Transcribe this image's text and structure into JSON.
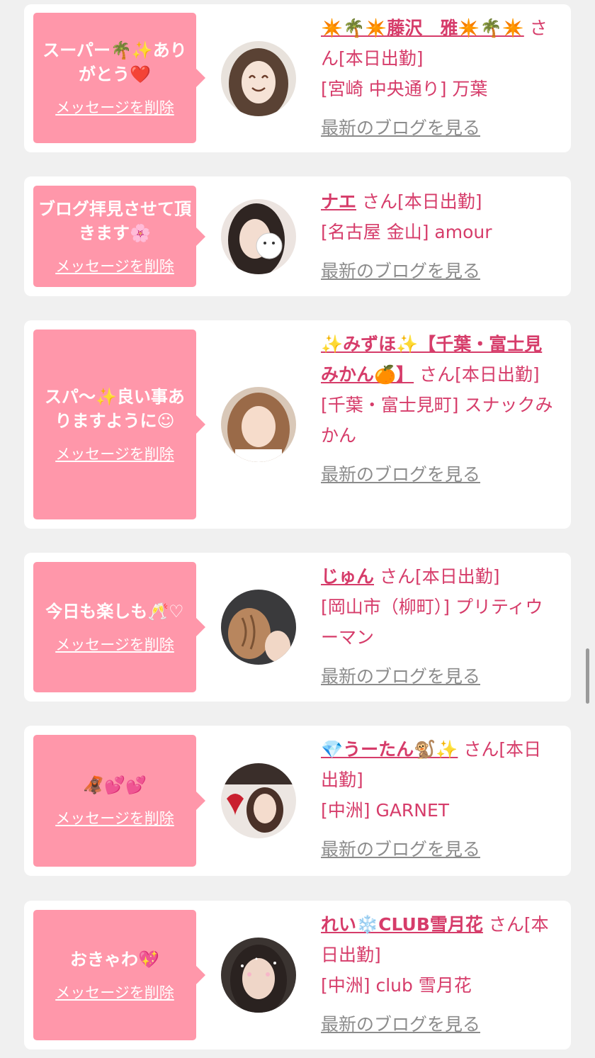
{
  "colors": {
    "bubble": "#ff97aa",
    "text_pink": "#d63c6a",
    "link_gray": "#8c8c8c",
    "page_bg": "#f0f0f0"
  },
  "entries": [
    {
      "message": "スーパー🌴✨ありがとう❤️",
      "delete_label": "メッセージを削除",
      "name": "✴️🌴✴️藤沢　雅✴️🌴✴️",
      "suffix": "さん[本日出勤]",
      "shop": "[宮崎 中央通り] 万葉",
      "blog_label": "最新のブログを見る"
    },
    {
      "message": "ブログ拝見させて頂きます🌸",
      "delete_label": "メッセージを削除",
      "name": "ナエ",
      "suffix": "さん[本日出勤]",
      "shop": "[名古屋 金山] amour",
      "blog_label": "最新のブログを見る"
    },
    {
      "message": "スパ〜✨良い事ありますように☺",
      "delete_label": "メッセージを削除",
      "name": "✨みずほ✨【千葉・富士見みかん🍊】",
      "suffix": "さん[本日出勤]",
      "shop": "[千葉・富士見町] スナックみかん",
      "blog_label": "最新のブログを見る"
    },
    {
      "message": "今日も楽しも🥂♡",
      "delete_label": "メッセージを削除",
      "name": "じゅん",
      "suffix": "さん[本日出勤]",
      "shop": "[岡山市（柳町）] プリティウーマン",
      "blog_label": "最新のブログを見る"
    },
    {
      "message": "🦧💕💕",
      "delete_label": "メッセージを削除",
      "name": "💎うーたん🐒✨",
      "suffix": "さん[本日出勤]",
      "shop": "[中洲] GARNET",
      "blog_label": "最新のブログを見る"
    },
    {
      "message": "おきゃわ💖",
      "delete_label": "メッセージを削除",
      "name": "れい❄️CLUB雪月花",
      "suffix": "さん[本日出勤]",
      "shop": "[中洲] club 雪月花",
      "blog_label": "最新のブログを見る"
    }
  ]
}
